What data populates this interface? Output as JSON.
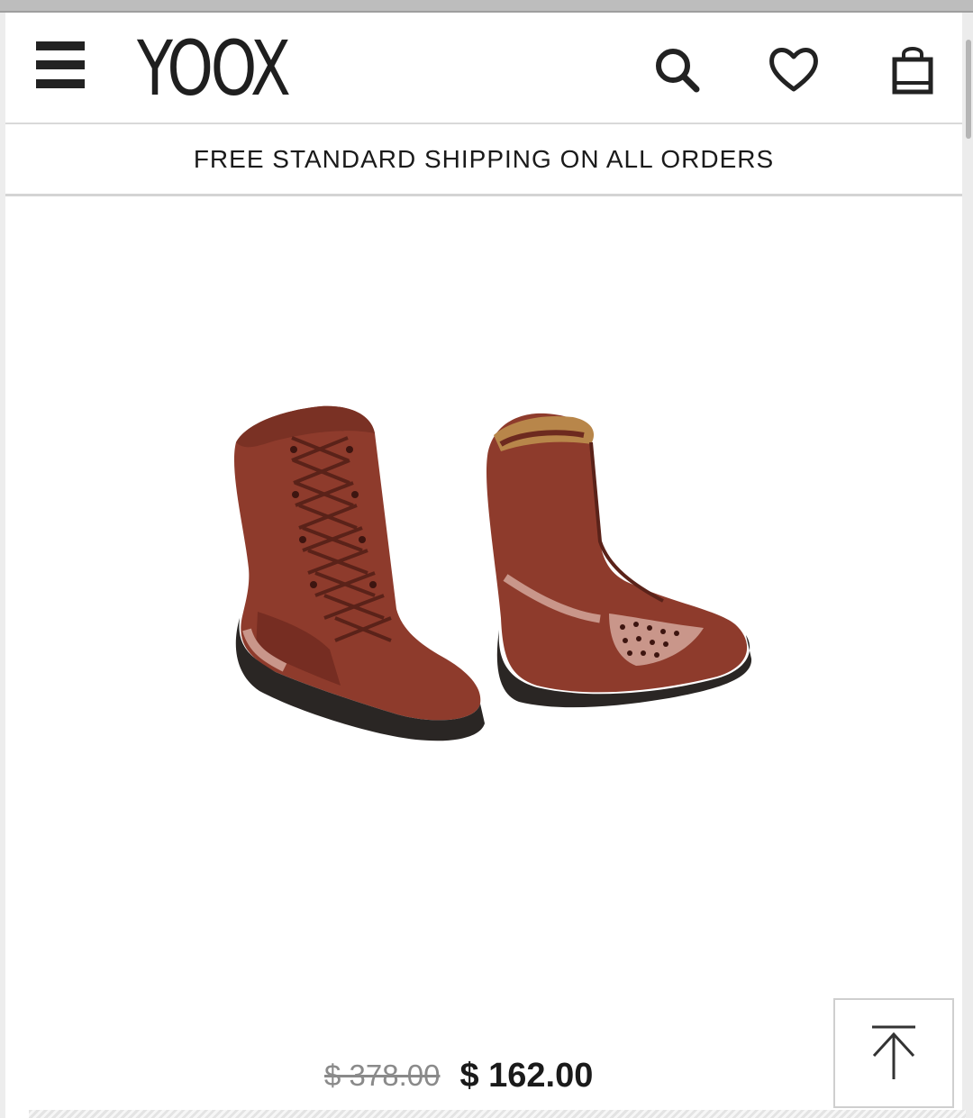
{
  "header": {
    "logo": "YOOX",
    "menu_icon": "hamburger-menu-icon",
    "search_icon": "search-icon",
    "wishlist_icon": "heart-icon",
    "bag_icon": "shopping-bag-icon"
  },
  "banner": {
    "text": "FREE STANDARD SHIPPING ON ALL ORDERS"
  },
  "product": {
    "image_subject": "reddish-brown suede lace-up ankle boots"
  },
  "price": {
    "original": "$ 378.00",
    "sale": "$ 162.00"
  },
  "back_to_top_icon": "arrow-up-to-top-icon",
  "colors": {
    "boot": "#8e3b2c",
    "boot_shadow": "#6d2a1f",
    "sole": "#2a2624",
    "accent_panel": "#c9968a"
  }
}
